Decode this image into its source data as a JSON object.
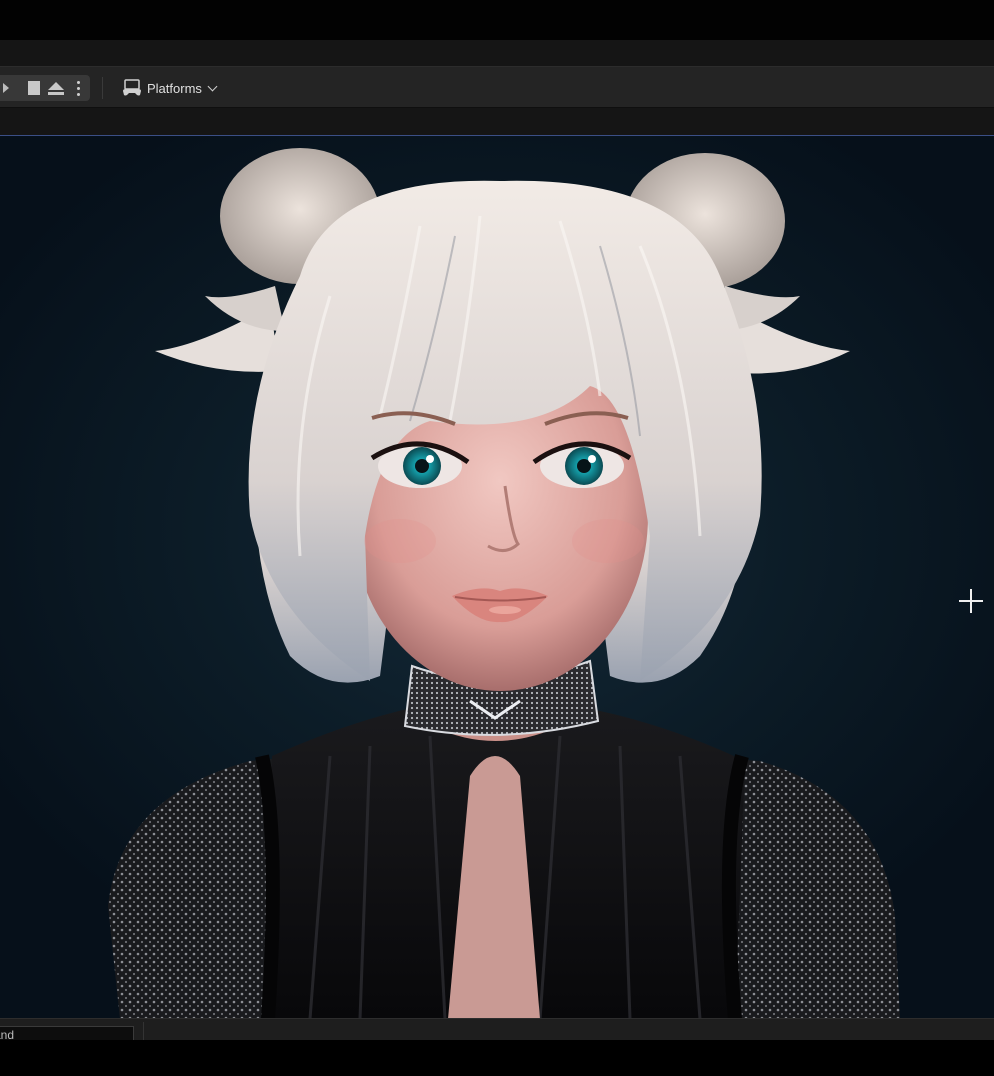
{
  "toolbar": {
    "platforms_label": "Platforms"
  },
  "bottom": {
    "command_text": "and"
  },
  "colors": {
    "toolbar_bg": "#242424",
    "viewport_border": "#3b4f86",
    "viewport_bg": "#0c1c27"
  },
  "icons": [
    "play-icon",
    "stop-icon",
    "eject-icon",
    "more-options-icon",
    "platforms-icon",
    "chevron-down-icon",
    "crosshair-icon"
  ]
}
